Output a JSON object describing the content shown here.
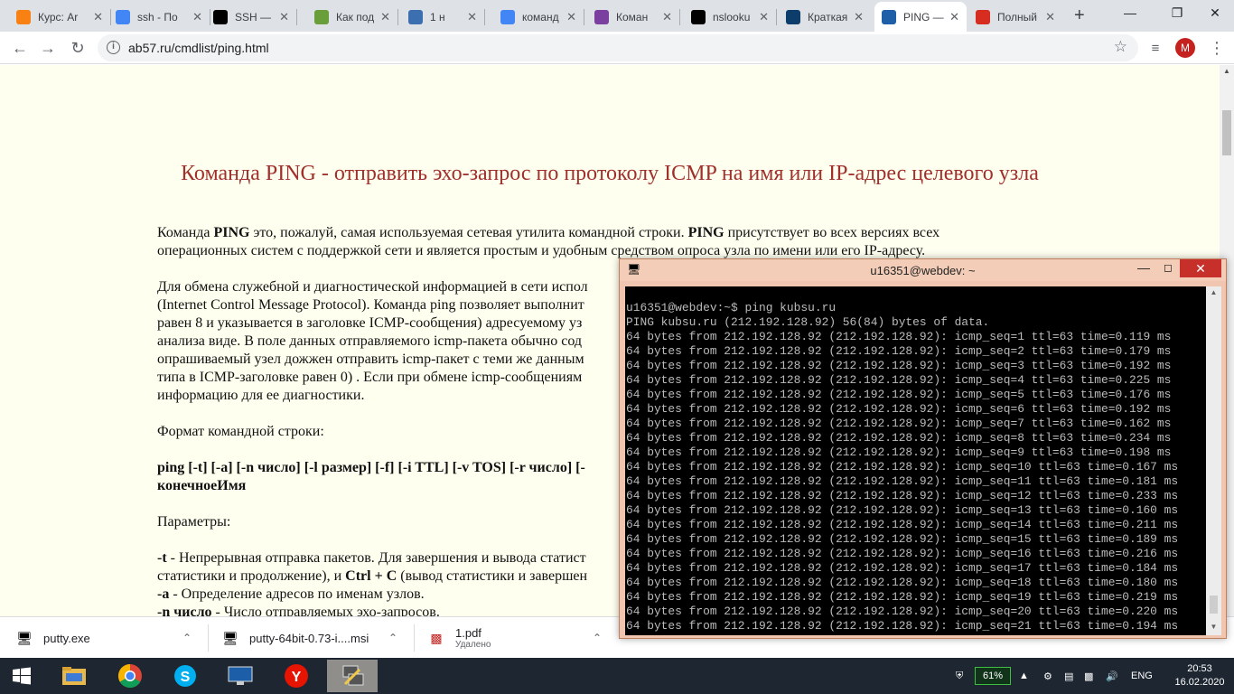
{
  "browser": {
    "tabs": [
      {
        "label": "Курс: Ar",
        "icon": "moodle-icon",
        "color": "#f98012"
      },
      {
        "label": "ssh - По",
        "icon": "google-icon",
        "color": "#4285f4"
      },
      {
        "label": "SSH — ",
        "icon": "wikipedia-icon",
        "color": "#000000"
      },
      {
        "label": "Как под",
        "icon": "leaf-icon",
        "color": "#6a9e3a"
      },
      {
        "label": "1 н",
        "icon": "vk-icon",
        "color": "#3b6fb0"
      },
      {
        "label": "команд",
        "icon": "google-icon",
        "color": "#4285f4"
      },
      {
        "label": "Коман",
        "icon": "c-icon",
        "color": "#7b3fa0"
      },
      {
        "label": "nslooku",
        "icon": "wikipedia-icon",
        "color": "#000000"
      },
      {
        "label": "Краткая",
        "icon": "r-icon",
        "color": "#0c3d6b"
      },
      {
        "label": "PING — ",
        "icon": "ab-icon",
        "color": "#1e5fa8"
      },
      {
        "label": "Полный",
        "icon": "star-icon",
        "color": "#d62d20"
      }
    ],
    "url": "ab57.ru/cmdlist/ping.html",
    "avatar_letter": "M"
  },
  "article": {
    "title": "Команда PING -  отправить эхо-запрос по протоколу ICMP на имя или IP-адрес целевого узла",
    "para1_a": "Команда ",
    "para1_b": "PING",
    "para1_c": " это, пожалуй, самая используемая сетевая утилита командной строки. ",
    "para1_d": "PING",
    "para1_e": " присутствует во всех версиях всех",
    "para1_line2": "операционных систем с поддержкой сети и является простым и удобным средством опроса узла по имени или его IP-адресу.",
    "para2_lines": [
      "Для обмена служебной и диагностической информацией в сети испол",
      "(Internet Control Message Protocol). Команда ping позволяет выполнит",
      "равен 8 и указывается в заголовке ICMP-сообщения) адресуемому уз",
      "анализа виде. В поле данных отправляемого icmp-пакета обычно сод",
      "опрашиваемый узел дожжен отправить icmp-пакет с теми же данным",
      "типа в ICMP-заголовке равен 0) . Если при обмене icmp-сообщениям",
      "информацию для ее диагностики."
    ],
    "format_label": "Формат командной строки:",
    "syntax_line1": "ping [-t] [-a] [-n число] [-l размер] [-f] [-i TTL] [-v TOS] [-r число] [-",
    "syntax_line2": "конечноеИмя",
    "params_label": "Параметры:",
    "param_t_flag": "-t",
    "param_t_text": " - Непрерывная отправка пакетов. Для завершения и вывода статист",
    "param_t_line2_a": "статистики и продолжение), и ",
    "param_t_line2_b": "Ctrl + C",
    "param_t_line2_c": " (вывод статистики и завершен",
    "param_a_flag": "-a",
    "param_a_text": " - Определение адресов по именам узлов.",
    "param_n_flag": "-n число",
    "param_n_text": " - Число отправляемых эхо-запросов."
  },
  "downloads": [
    {
      "name": "putty.exe",
      "sub": ""
    },
    {
      "name": "putty-64bit-0.73-i....msi",
      "sub": ""
    },
    {
      "name": "1.pdf",
      "sub": "Удалено"
    }
  ],
  "putty": {
    "title": "u16351@webdev: ~",
    "terminal": [
      "u16351@webdev:~$ ping kubsu.ru",
      "PING kubsu.ru (212.192.128.92) 56(84) bytes of data.",
      "64 bytes from 212.192.128.92 (212.192.128.92): icmp_seq=1 ttl=63 time=0.119 ms",
      "64 bytes from 212.192.128.92 (212.192.128.92): icmp_seq=2 ttl=63 time=0.179 ms",
      "64 bytes from 212.192.128.92 (212.192.128.92): icmp_seq=3 ttl=63 time=0.192 ms",
      "64 bytes from 212.192.128.92 (212.192.128.92): icmp_seq=4 ttl=63 time=0.225 ms",
      "64 bytes from 212.192.128.92 (212.192.128.92): icmp_seq=5 ttl=63 time=0.176 ms",
      "64 bytes from 212.192.128.92 (212.192.128.92): icmp_seq=6 ttl=63 time=0.192 ms",
      "64 bytes from 212.192.128.92 (212.192.128.92): icmp_seq=7 ttl=63 time=0.162 ms",
      "64 bytes from 212.192.128.92 (212.192.128.92): icmp_seq=8 ttl=63 time=0.234 ms",
      "64 bytes from 212.192.128.92 (212.192.128.92): icmp_seq=9 ttl=63 time=0.198 ms",
      "64 bytes from 212.192.128.92 (212.192.128.92): icmp_seq=10 ttl=63 time=0.167 ms",
      "64 bytes from 212.192.128.92 (212.192.128.92): icmp_seq=11 ttl=63 time=0.181 ms",
      "64 bytes from 212.192.128.92 (212.192.128.92): icmp_seq=12 ttl=63 time=0.233 ms",
      "64 bytes from 212.192.128.92 (212.192.128.92): icmp_seq=13 ttl=63 time=0.160 ms",
      "64 bytes from 212.192.128.92 (212.192.128.92): icmp_seq=14 ttl=63 time=0.211 ms",
      "64 bytes from 212.192.128.92 (212.192.128.92): icmp_seq=15 ttl=63 time=0.189 ms",
      "64 bytes from 212.192.128.92 (212.192.128.92): icmp_seq=16 ttl=63 time=0.216 ms",
      "64 bytes from 212.192.128.92 (212.192.128.92): icmp_seq=17 ttl=63 time=0.184 ms",
      "64 bytes from 212.192.128.92 (212.192.128.92): icmp_seq=18 ttl=63 time=0.180 ms",
      "64 bytes from 212.192.128.92 (212.192.128.92): icmp_seq=19 ttl=63 time=0.219 ms",
      "64 bytes from 212.192.128.92 (212.192.128.92): icmp_seq=20 ttl=63 time=0.220 ms",
      "64 bytes from 212.192.128.92 (212.192.128.92): icmp_seq=21 ttl=63 time=0.194 ms"
    ]
  },
  "taskbar": {
    "battery": "61%",
    "language": "ENG",
    "time": "20:53",
    "date": "16.02.2020"
  }
}
